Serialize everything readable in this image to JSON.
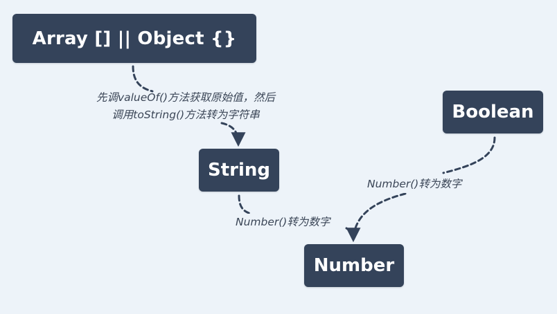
{
  "nodes": {
    "array_object": {
      "label": "Array [] || Object {}"
    },
    "string": {
      "label": "String"
    },
    "boolean": {
      "label": "Boolean"
    },
    "number": {
      "label": "Number"
    }
  },
  "edges": {
    "array_to_string": {
      "label_line1": "先调valueOf()方法获取原始值，然后",
      "label_line2": "调用toString()方法转为字符串"
    },
    "string_to_number": {
      "label": "Number()转为数字"
    },
    "boolean_to_number": {
      "label": "Number()转为数字"
    }
  },
  "colors": {
    "background": "#edf3f9",
    "node_fill": "#34435a",
    "node_text": "#ffffff",
    "connector": "#34435a"
  }
}
